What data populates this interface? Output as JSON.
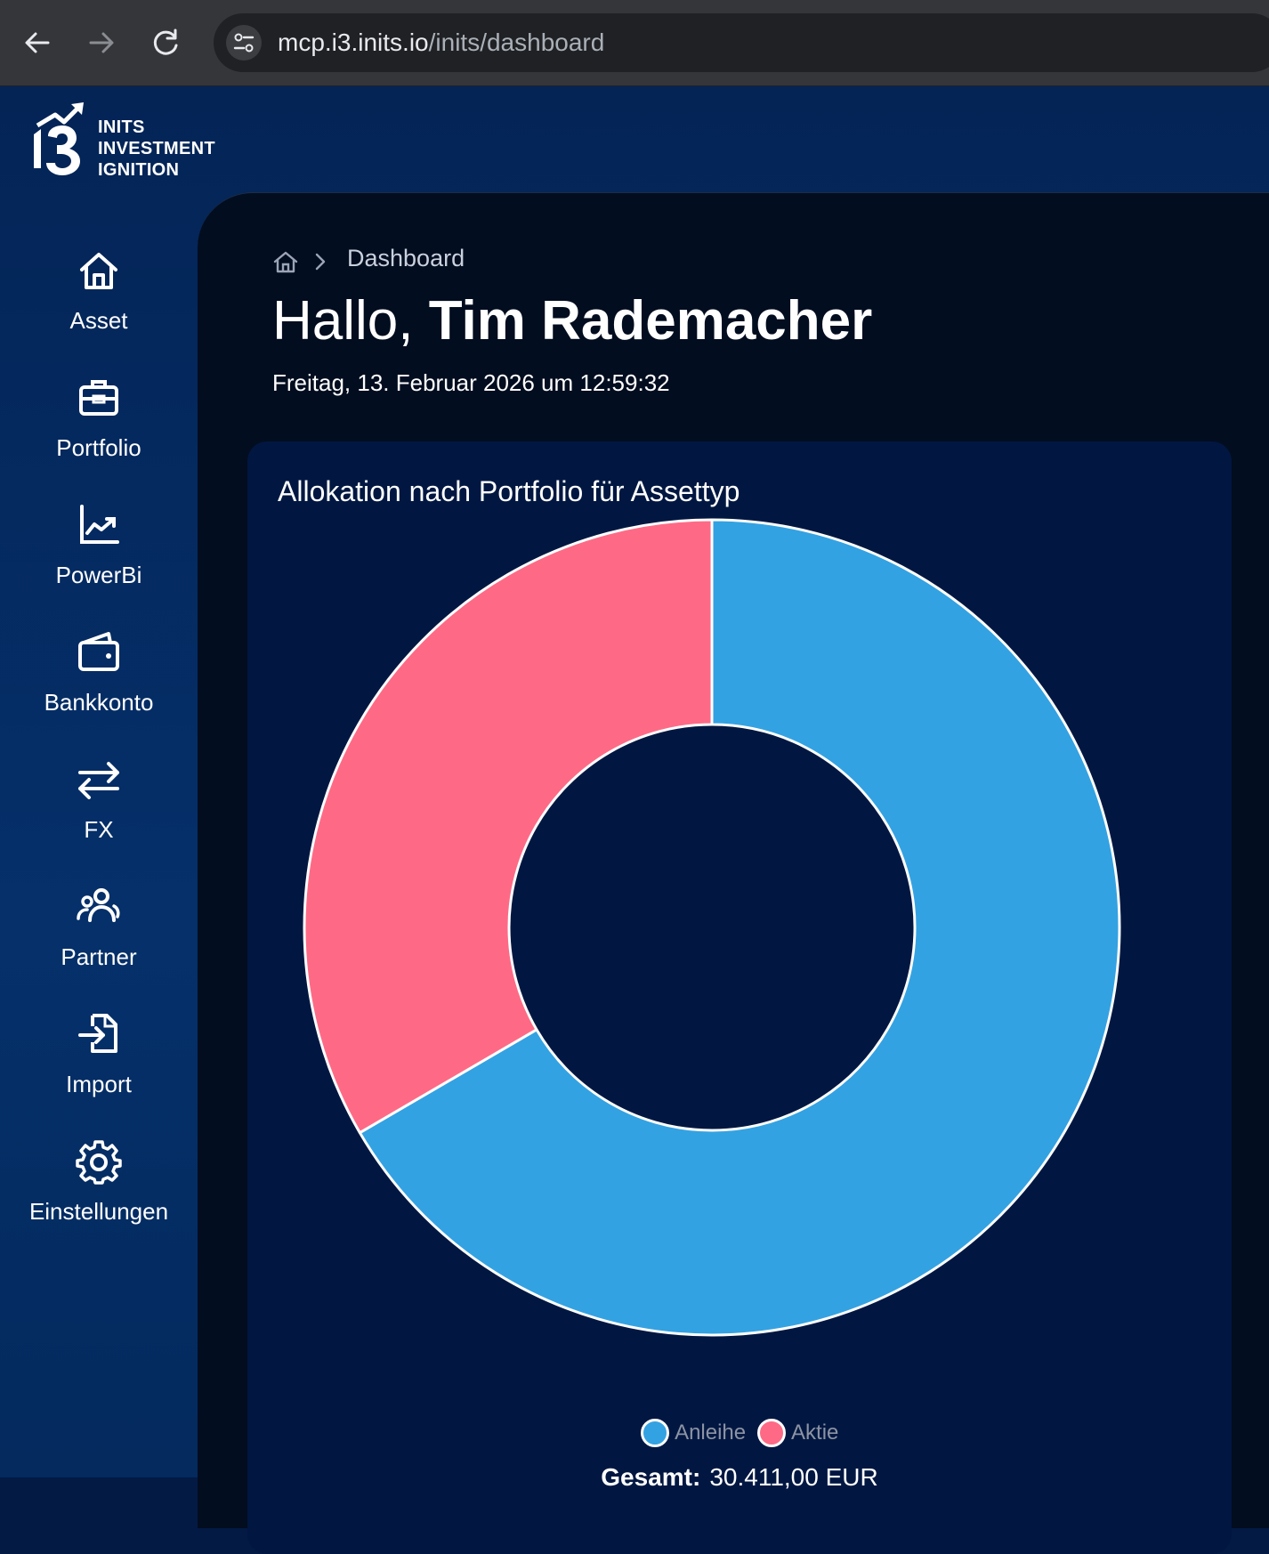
{
  "browser": {
    "url_host": "mcp.i3.inits.io",
    "url_path": "/inits/dashboard"
  },
  "logo": {
    "mark": "i3",
    "line1": "INITS",
    "line2": "INVESTMENT",
    "line3": "IGNITION"
  },
  "sidebar": {
    "items": [
      {
        "label": "Asset",
        "icon": "home-icon"
      },
      {
        "label": "Portfolio",
        "icon": "briefcase-icon"
      },
      {
        "label": "PowerBi",
        "icon": "chart-line-icon"
      },
      {
        "label": "Bankkonto",
        "icon": "wallet-icon"
      },
      {
        "label": "FX",
        "icon": "exchange-icon"
      },
      {
        "label": "Partner",
        "icon": "users-icon"
      },
      {
        "label": "Import",
        "icon": "file-import-icon"
      },
      {
        "label": "Einstellungen",
        "icon": "gear-icon"
      }
    ]
  },
  "breadcrumb": {
    "current": "Dashboard"
  },
  "greeting": {
    "hello": "Hallo,",
    "name": "Tim Rademacher"
  },
  "date_line": "Freitag, 13. Februar 2026 um 12:59:32",
  "colors": {
    "anleihe": "#33a2e2",
    "aktie": "#fe6a86",
    "card_bg": "#011741"
  },
  "chart_data": {
    "type": "pie",
    "title": "Allokation nach Portfolio für Assettyp",
    "donut": true,
    "categories": [
      "Anleihe",
      "Aktie"
    ],
    "values": [
      66.6,
      33.4
    ],
    "legend_position": "bottom",
    "total_label": "Gesamt:",
    "total_value": "30.411,00 EUR"
  }
}
